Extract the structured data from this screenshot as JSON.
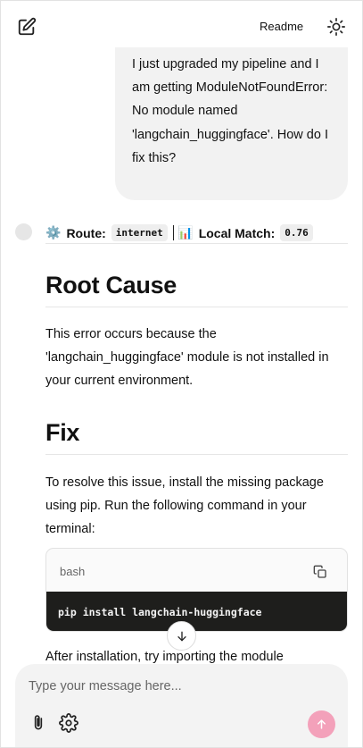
{
  "header": {
    "new_chat_icon": "edit-square-icon",
    "readme_label": "Readme",
    "theme_icon": "sun-icon"
  },
  "conversation": {
    "user_message": "I just upgraded my pipeline and I am getting ModuleNotFoundError: No module named 'langchain_huggingface'. How do I fix this?",
    "assistant": {
      "route_label": "Route:",
      "route_value": "internet",
      "match_label": "Local Match:",
      "match_value": "0.76",
      "route_emoji": "⚙️",
      "match_emoji": "📊",
      "root_cause_heading": "Root Cause",
      "root_cause_text": "This error occurs because the 'langchain_huggingface' module is not installed in your current environment.",
      "fix_heading": "Fix",
      "fix_text": "To resolve this issue, install the missing package using pip. Run the following command in your terminal:",
      "code_language": "bash",
      "code": "pip install langchain-huggingface",
      "after_text": "After installation, try importing the module"
    }
  },
  "composer": {
    "placeholder": "Type your message here...",
    "attach_icon": "paperclip-icon",
    "settings_icon": "gear-icon",
    "send_icon": "arrow-up-icon"
  },
  "colors": {
    "send_button": "#f3a1ba",
    "bubble": "#f2f2f2",
    "code_background": "#1e1e1c"
  }
}
